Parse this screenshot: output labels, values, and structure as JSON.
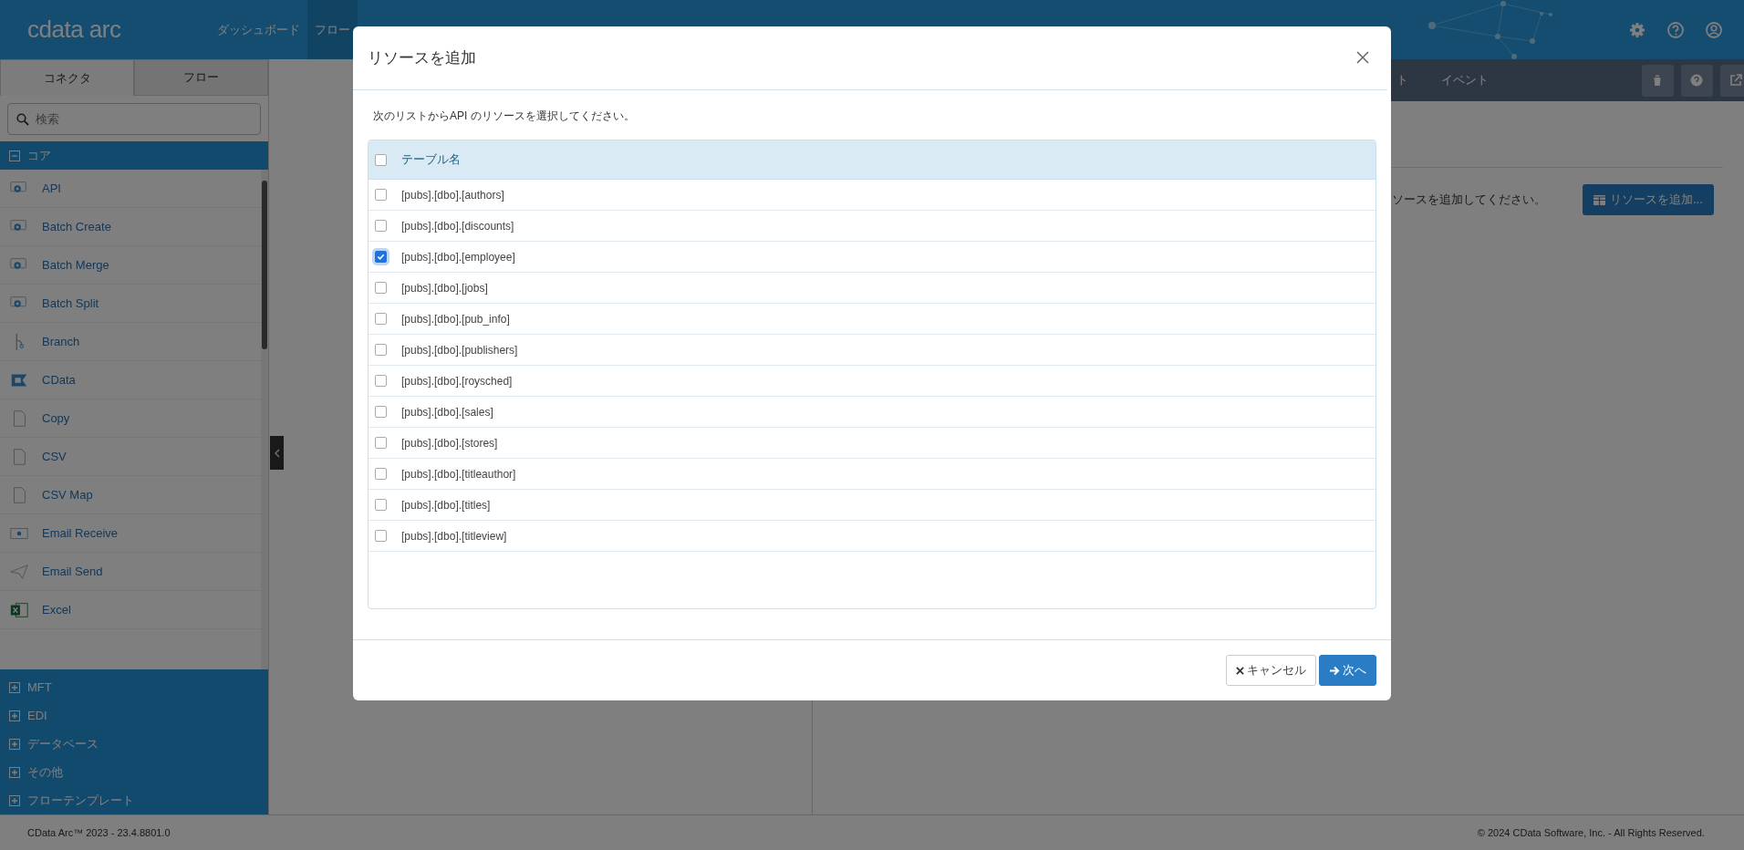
{
  "topbar": {
    "logo": "cdata arc",
    "nav": [
      {
        "label": "ダッシュボード",
        "selected": false
      },
      {
        "label": "フロー",
        "selected": true
      }
    ]
  },
  "sidebar": {
    "tabs": [
      {
        "label": "コネクタ",
        "selected": true
      },
      {
        "label": "フロー",
        "selected": false
      }
    ],
    "search": {
      "placeholder": "検索"
    },
    "categories": [
      {
        "label": "コア",
        "expanded": true,
        "items": [
          "API",
          "Batch Create",
          "Batch Merge",
          "Batch Split",
          "Branch",
          "CData",
          "Copy",
          "CSV",
          "CSV Map",
          "Email Receive",
          "Email Send",
          "Excel"
        ]
      },
      {
        "label": "MFT",
        "expanded": false
      },
      {
        "label": "EDI",
        "expanded": false
      },
      {
        "label": "データベース",
        "expanded": false
      },
      {
        "label": "その他",
        "expanded": false
      },
      {
        "label": "フローテンプレート",
        "expanded": false
      }
    ]
  },
  "right_panel": {
    "tabs": [
      "ト",
      "イベント"
    ],
    "message": "ソースを追加してください。",
    "add_button": "リソースを追加..."
  },
  "footer": {
    "version": "CData Arc™ 2023 - 23.4.8801.0",
    "copyright": "© 2024 CData Software, Inc. - All Rights Reserved."
  },
  "modal": {
    "title": "リソースを追加",
    "instruction": "次のリストからAPI のリソースを選択してください。",
    "table": {
      "header": {
        "label": "テーブル名",
        "checked": false
      },
      "rows": [
        {
          "name": "[pubs].[dbo].[authors]",
          "checked": false
        },
        {
          "name": "[pubs].[dbo].[discounts]",
          "checked": false
        },
        {
          "name": "[pubs].[dbo].[employee]",
          "checked": true
        },
        {
          "name": "[pubs].[dbo].[jobs]",
          "checked": false
        },
        {
          "name": "[pubs].[dbo].[pub_info]",
          "checked": false
        },
        {
          "name": "[pubs].[dbo].[publishers]",
          "checked": false
        },
        {
          "name": "[pubs].[dbo].[roysched]",
          "checked": false
        },
        {
          "name": "[pubs].[dbo].[sales]",
          "checked": false
        },
        {
          "name": "[pubs].[dbo].[stores]",
          "checked": false
        },
        {
          "name": "[pubs].[dbo].[titleauthor]",
          "checked": false
        },
        {
          "name": "[pubs].[dbo].[titles]",
          "checked": false
        },
        {
          "name": "[pubs].[dbo].[titleview]",
          "checked": false
        }
      ]
    },
    "buttons": [
      {
        "label": "キャンセル",
        "kind": "cancel"
      },
      {
        "label": "次へ",
        "kind": "primary"
      }
    ]
  }
}
